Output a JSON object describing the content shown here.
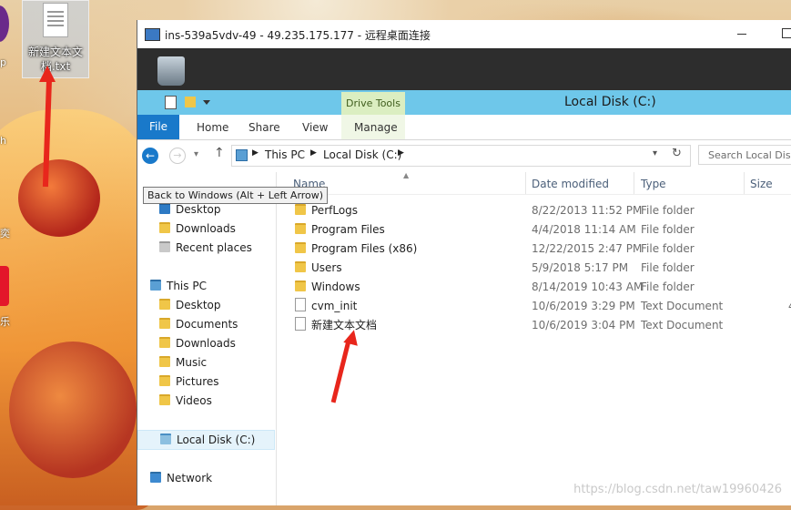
{
  "desktop": {
    "file_icon_label": "新建文本文档.txt",
    "edge_labels": [
      "p",
      "h",
      "奕",
      "乐"
    ]
  },
  "rdp": {
    "title": "ins-539a5vdv-49 - 49.235.175.177 - 远程桌面连接"
  },
  "explorer": {
    "window_title": "Local Disk (C:)",
    "context_tab": "Drive Tools",
    "tabs": [
      "File",
      "Home",
      "Share",
      "View",
      "Manage"
    ],
    "breadcrumb": [
      "This PC",
      "Local Disk (C:)"
    ],
    "search_placeholder": "Search Local Disk",
    "tooltip": "Back to Windows (Alt + Left Arrow)",
    "nav": {
      "quick": [
        "Desktop",
        "Downloads",
        "Recent places"
      ],
      "this_pc_label": "This PC",
      "this_pc": [
        "Desktop",
        "Documents",
        "Downloads",
        "Music",
        "Pictures",
        "Videos",
        "Local Disk (C:)"
      ],
      "network": "Network"
    },
    "columns": [
      "Name",
      "Date modified",
      "Type",
      "Size"
    ],
    "files": [
      {
        "name": "PerfLogs",
        "date": "8/22/2013 11:52 PM",
        "type": "File folder",
        "size": "",
        "kind": "folder"
      },
      {
        "name": "Program Files",
        "date": "4/4/2018 11:14 AM",
        "type": "File folder",
        "size": "",
        "kind": "folder"
      },
      {
        "name": "Program Files (x86)",
        "date": "12/22/2015 2:47 PM",
        "type": "File folder",
        "size": "",
        "kind": "folder"
      },
      {
        "name": "Users",
        "date": "5/9/2018 5:17 PM",
        "type": "File folder",
        "size": "",
        "kind": "folder"
      },
      {
        "name": "Windows",
        "date": "8/14/2019 10:43 AM",
        "type": "File folder",
        "size": "",
        "kind": "folder"
      },
      {
        "name": "cvm_init",
        "date": "10/6/2019 3:29 PM",
        "type": "Text Document",
        "size": "4",
        "kind": "doc"
      },
      {
        "name": "新建文本文档",
        "date": "10/6/2019 3:04 PM",
        "type": "Text Document",
        "size": "",
        "kind": "doc"
      }
    ]
  },
  "watermark": "https://blog.csdn.net/taw19960426",
  "colors": {
    "accent": "#1979ca",
    "arrow": "#e8261c"
  }
}
